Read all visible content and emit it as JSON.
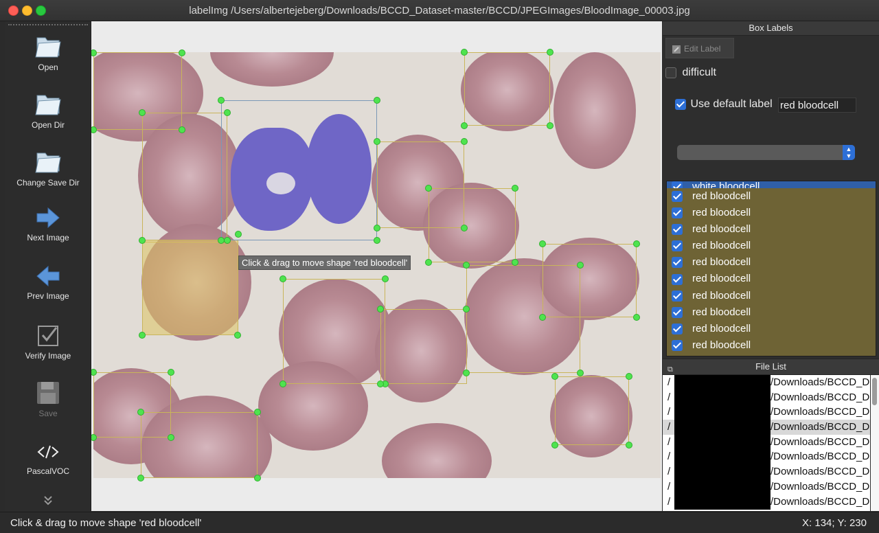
{
  "window": {
    "title": "labelImg /Users/albertejeberg/Downloads/BCCD_Dataset-master/BCCD/JPEGImages/BloodImage_00003.jpg"
  },
  "toolbar": {
    "items": [
      {
        "label": "Open",
        "icon": "folder-icon",
        "enabled": true
      },
      {
        "label": "Open Dir",
        "icon": "folder-icon",
        "enabled": true
      },
      {
        "label": "Change Save Dir",
        "icon": "folder-icon",
        "enabled": true
      },
      {
        "label": "Next Image",
        "icon": "arrow-right-icon",
        "enabled": true
      },
      {
        "label": "Prev Image",
        "icon": "arrow-left-icon",
        "enabled": true
      },
      {
        "label": "Verify Image",
        "icon": "checkbox-icon",
        "enabled": false
      },
      {
        "label": "Save",
        "icon": "floppy-icon",
        "enabled": false
      },
      {
        "label": "PascalVOC",
        "icon": "code-icon",
        "enabled": true
      }
    ]
  },
  "canvas": {
    "tooltip": "Click & drag to move shape 'red bloodcell'"
  },
  "box_labels": {
    "title": "Box Labels",
    "edit_label": "Edit Label",
    "difficult_label": "difficult",
    "difficult_checked": false,
    "use_default_label": "Use default label",
    "use_default_checked": true,
    "default_label_value": "red bloodcell",
    "labels": [
      "white bloodcell",
      "red bloodcell",
      "red bloodcell",
      "red bloodcell",
      "red bloodcell",
      "red bloodcell",
      "red bloodcell",
      "red bloodcell",
      "red bloodcell",
      "red bloodcell",
      "red bloodcell"
    ],
    "list_bg_color": "#6e6335"
  },
  "file_list": {
    "title": "File List",
    "items": [
      {
        "prefix": "/",
        "path": "/Downloads/BCCD_D"
      },
      {
        "prefix": "/",
        "path": "/Downloads/BCCD_D"
      },
      {
        "prefix": "/",
        "path": "/Downloads/BCCD_D"
      },
      {
        "prefix": "/",
        "path": "/Downloads/BCCD_D"
      },
      {
        "prefix": "/",
        "path": "/Downloads/BCCD_D"
      },
      {
        "prefix": "/",
        "path": "/Downloads/BCCD_D"
      },
      {
        "prefix": "/",
        "path": "/Downloads/BCCD_D"
      },
      {
        "prefix": "/",
        "path": "/Downloads/BCCD_D"
      },
      {
        "prefix": "/",
        "path": "/Downloads/BCCD_D"
      }
    ],
    "selected_index": 3
  },
  "status": {
    "message": "Click & drag to move shape 'red bloodcell'",
    "coords": "X: 134; Y: 230"
  },
  "colors": {
    "handle": "#4fe34f",
    "box_border": "#c9b55a",
    "selected_fill": "#dec462",
    "accent": "#2d6fd6"
  }
}
